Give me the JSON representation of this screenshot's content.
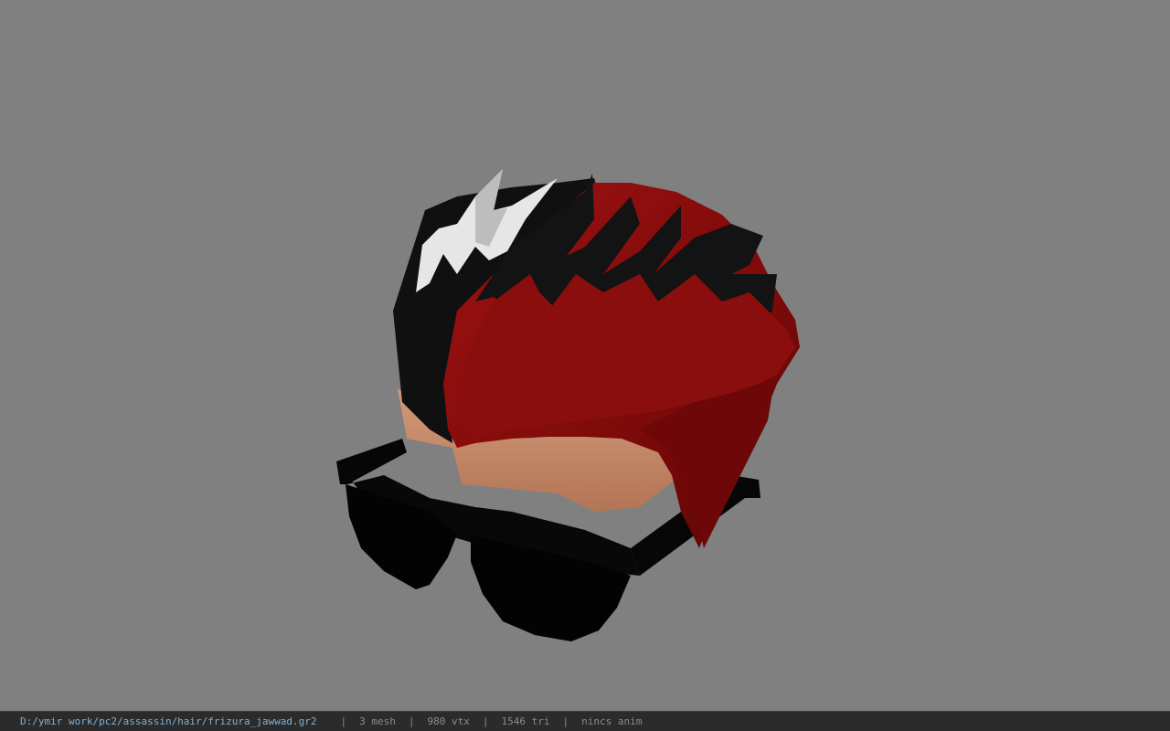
{
  "viewport": {
    "background": "#808080",
    "model_colors": {
      "hair_red": "#8c0f0f",
      "hair_dark_red": "#5e0606",
      "hair_black": "#111111",
      "hair_white": "#e8e8e8",
      "skin": "#c48a6a",
      "glasses": "#050505"
    }
  },
  "statusbar": {
    "file_path": "D:/ymir work/pc2/assassin/hair/frizura_jawwad.gr2",
    "mesh_count": "3 mesh",
    "vertex_count": "980 vtx",
    "triangle_count": "1546 tri",
    "anim_status": "nincs anim",
    "separator": "|"
  }
}
